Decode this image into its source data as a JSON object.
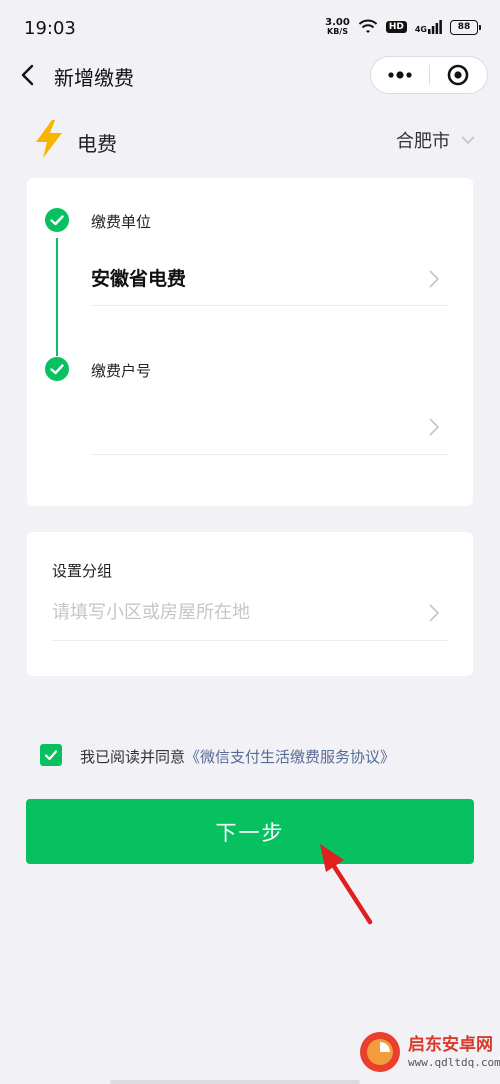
{
  "status_bar": {
    "time": "19:03",
    "speed_value": "3.00",
    "speed_unit": "KB/S",
    "hd": "HD",
    "network": "4G",
    "battery": "88"
  },
  "nav": {
    "title": "新增缴费"
  },
  "category": {
    "label": "电费",
    "city": "合肥市"
  },
  "payment_card": {
    "unit_label": "缴费单位",
    "unit_value": "安徽省电费",
    "account_label": "缴费户号",
    "account_value": ""
  },
  "group_card": {
    "label": "设置分组",
    "placeholder": "请填写小区或房屋所在地"
  },
  "agreement": {
    "prefix": "我已阅读并同意",
    "link": "《微信支付生活缴费服务协议》",
    "checked": true
  },
  "next_button": {
    "label": "下一步"
  },
  "watermark": {
    "brand": "启东安卓网",
    "url": "www.qdltdq.com"
  },
  "colors": {
    "primary": "#07c160",
    "link": "#576b95",
    "bolt": "#f7b500",
    "annotation_arrow": "#e02020"
  }
}
